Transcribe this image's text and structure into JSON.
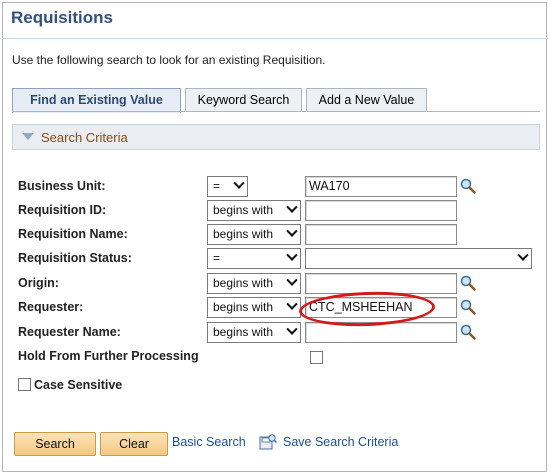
{
  "page": {
    "title": "Requisitions",
    "instructions": "Use the following search to look for an existing Requisition."
  },
  "tabs": [
    {
      "label": "Find an Existing Value",
      "active": true
    },
    {
      "label": "Keyword Search",
      "active": false
    },
    {
      "label": "Add a New Value",
      "active": false
    }
  ],
  "criteria": {
    "section_label": "Search Criteria",
    "fields": [
      {
        "label": "Business Unit:",
        "operator": "=",
        "value": "WA170",
        "lookup": true
      },
      {
        "label": "Requisition ID:",
        "operator": "begins with",
        "value": "",
        "lookup": false
      },
      {
        "label": "Requisition Name:",
        "operator": "begins with",
        "value": "",
        "lookup": false
      },
      {
        "label": "Requisition Status:",
        "operator": "=",
        "value": "",
        "lookup": false
      },
      {
        "label": "Origin:",
        "operator": "begins with",
        "value": "",
        "lookup": true
      },
      {
        "label": "Requester:",
        "operator": "begins with",
        "value": "CTC_MSHEEHAN",
        "lookup": true
      },
      {
        "label": "Requester Name:",
        "operator": "begins with",
        "value": "",
        "lookup": true
      }
    ],
    "hold_label": "Hold From Further Processing",
    "case_sensitive_label": "Case Sensitive"
  },
  "actions": {
    "search": "Search",
    "clear": "Clear",
    "basic_search": "Basic Search",
    "save_search": "Save Search Criteria"
  },
  "colors": {
    "title": "#35527c",
    "criteria_label": "#8a4b12",
    "button": "#f3c982",
    "link": "#1d4f8f",
    "annotation_ring": "#d11c1c"
  }
}
